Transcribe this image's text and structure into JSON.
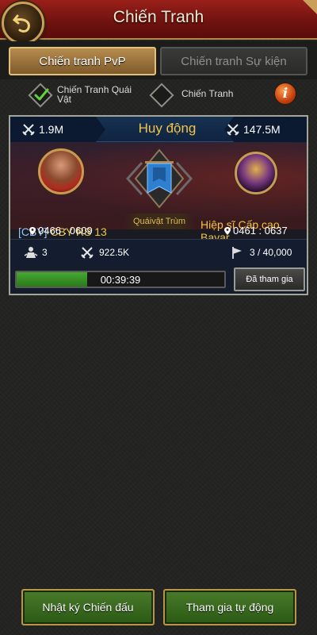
{
  "header": {
    "title": "Chiến Tranh"
  },
  "tabs": [
    {
      "label": "Chiến tranh PvP",
      "active": true
    },
    {
      "label": "Chiến tranh Sự kiện",
      "active": false
    }
  ],
  "filters": [
    {
      "label": "Chiến Tranh Quái Vật",
      "checked": true
    },
    {
      "label": "Chiến Tranh",
      "checked": false
    }
  ],
  "war": {
    "title": "Huy động",
    "left_power": "1.9M",
    "right_power": "147.5M",
    "target_label": "Quáivật Trùm",
    "attacker": {
      "tag": "[CBY]",
      "name": "CBY RS 13",
      "coords": "0466 : 0609"
    },
    "defender": {
      "name": "Hiệp sĩ Cấp cao Bayar",
      "coords": "0461 : 0637"
    },
    "stats": {
      "count": "3",
      "power": "922.5K",
      "capacity": "3 / 40,000"
    },
    "timer": "00:39:39",
    "progress": 0.34,
    "joined_label": "Đã tham gia"
  },
  "buttons": {
    "log": "Nhật ký Chiến đấu",
    "auto_join": "Tham gia tự động"
  },
  "colors": {
    "accent_gold": "#f1c34a",
    "header_red": "#8a1a16",
    "progress_green": "#45a830"
  }
}
